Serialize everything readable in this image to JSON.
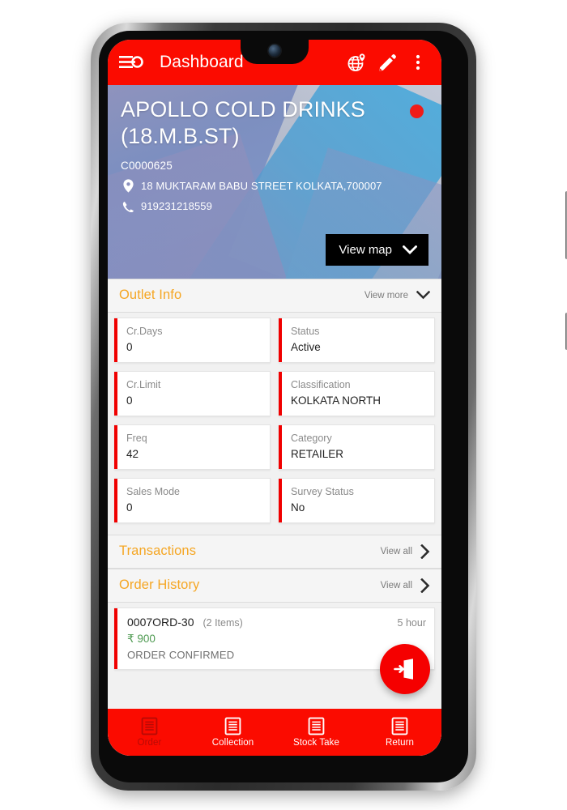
{
  "app_bar": {
    "title": "Dashboard",
    "menu_icon": "hamburger-menu-icon",
    "actions": [
      {
        "name": "globe-location-icon"
      },
      {
        "name": "edit-pencil-icon"
      },
      {
        "name": "overflow-menu-icon"
      }
    ]
  },
  "outlet": {
    "name": "APOLLO COLD DRINKS (18.M.B.ST)",
    "code": "C0000625",
    "address": "18 MUKTARAM BABU STREET KOLKATA,700007",
    "phone": "919231218559",
    "status_color": "#ef1c18",
    "view_map_label": "View map"
  },
  "outlet_info": {
    "title": "Outlet Info",
    "action_label": "View more",
    "accent_color": "#f00000",
    "rows": [
      [
        {
          "label": "Cr.Days",
          "value": "0"
        },
        {
          "label": "Status",
          "value": "Active"
        }
      ],
      [
        {
          "label": "Cr.Limit",
          "value": "0"
        },
        {
          "label": "Classification",
          "value": "KOLKATA NORTH"
        }
      ],
      [
        {
          "label": "Freq",
          "value": "42"
        },
        {
          "label": "Category",
          "value": "RETAILER"
        }
      ],
      [
        {
          "label": "Sales Mode",
          "value": "0"
        },
        {
          "label": "Survey Status",
          "value": "No"
        }
      ]
    ]
  },
  "transactions": {
    "title": "Transactions",
    "action_label": "View all"
  },
  "order_history": {
    "title": "Order History",
    "action_label": "View all",
    "orders": [
      {
        "id": "0007ORD-30",
        "items": "(2 Items)",
        "time": "5 hour",
        "amount": "₹ 900",
        "status": "ORDER CONFIRMED"
      }
    ]
  },
  "fab": {
    "icon": "check-in-door-icon"
  },
  "bottom_nav": {
    "items": [
      {
        "label": "Order",
        "icon": "order-document-icon",
        "active": true
      },
      {
        "label": "Collection",
        "icon": "collection-document-icon",
        "active": false
      },
      {
        "label": "Stock Take",
        "icon": "stock-take-document-icon",
        "active": false
      },
      {
        "label": "Return",
        "icon": "return-document-icon",
        "active": false
      }
    ]
  },
  "theme": {
    "primary_red": "#fb0b00",
    "accent_orange": "#f5a623",
    "amount_green": "#4e9a51"
  }
}
